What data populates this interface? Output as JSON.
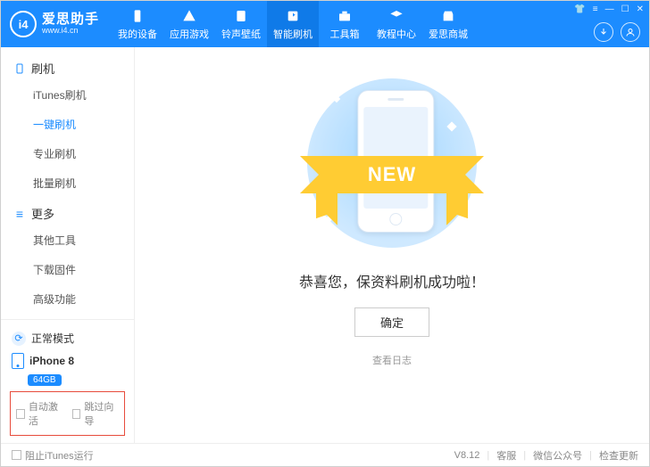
{
  "brand": {
    "cn": "爱思助手",
    "en": "www.i4.cn",
    "logo_text": "i4"
  },
  "nav": [
    {
      "id": "device",
      "label": "我的设备"
    },
    {
      "id": "apps",
      "label": "应用游戏"
    },
    {
      "id": "ringtone",
      "label": "铃声壁纸"
    },
    {
      "id": "flash",
      "label": "智能刷机"
    },
    {
      "id": "toolbox",
      "label": "工具箱"
    },
    {
      "id": "tutorial",
      "label": "教程中心"
    },
    {
      "id": "store",
      "label": "爱思商城"
    }
  ],
  "nav_active_index": 3,
  "sidebar": {
    "groups": [
      {
        "title": "刷机",
        "icon": "phone-icon",
        "items": [
          {
            "label": "iTunes刷机"
          },
          {
            "label": "一键刷机",
            "active": true
          },
          {
            "label": "专业刷机"
          },
          {
            "label": "批量刷机"
          }
        ]
      },
      {
        "title": "更多",
        "icon": "more-icon",
        "items": [
          {
            "label": "其他工具"
          },
          {
            "label": "下载固件"
          },
          {
            "label": "高级功能"
          }
        ]
      }
    ],
    "mode_label": "正常模式",
    "device_name": "iPhone 8",
    "device_badge": "64GB",
    "auto_activate_label": "自动激活",
    "skip_guide_label": "跳过向导"
  },
  "main": {
    "ribbon_text": "NEW",
    "success_text": "恭喜您，保资料刷机成功啦！",
    "ok_label": "确定",
    "log_link_label": "查看日志"
  },
  "footer": {
    "block_itunes_label": "阻止iTunes运行",
    "version": "V8.12",
    "kefu": "客服",
    "wechat": "微信公众号",
    "update": "检查更新"
  }
}
